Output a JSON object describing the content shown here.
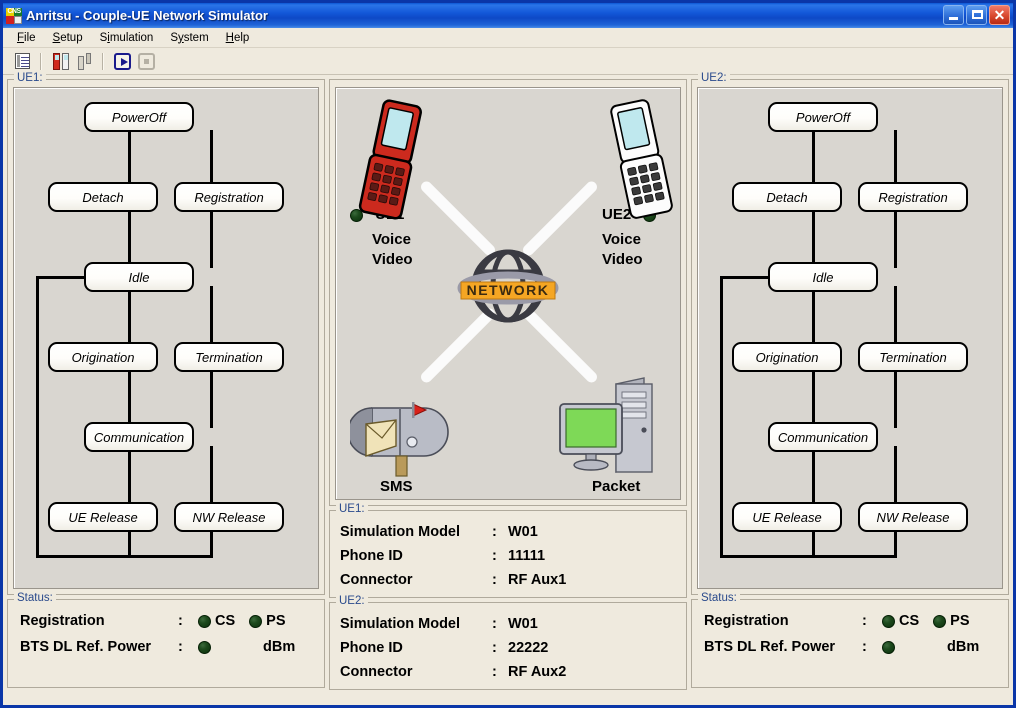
{
  "window": {
    "title": "Anritsu - Couple-UE Network Simulator",
    "icon": "app-icon",
    "buttons": {
      "minimize": "minimize",
      "maximize": "maximize",
      "close": "close"
    }
  },
  "menubar": {
    "items": [
      {
        "label": "File",
        "accel": "F",
        "rest": "ile"
      },
      {
        "label": "Setup",
        "accel": "S",
        "rest": "etup"
      },
      {
        "label": "Simulation",
        "accel": "i",
        "pre": "S",
        "rest": "mulation"
      },
      {
        "label": "System",
        "accel": "y",
        "pre": "S",
        "rest": "stem"
      },
      {
        "label": "Help",
        "accel": "H",
        "rest": "elp"
      }
    ]
  },
  "toolbar": {
    "items": [
      {
        "name": "list-icon",
        "enabled": true
      },
      {
        "name": "phone-pair-icon",
        "enabled": true
      },
      {
        "name": "bts-tower-icon",
        "enabled": true
      },
      {
        "name": "play-icon",
        "enabled": true
      },
      {
        "name": "stop-icon",
        "enabled": false
      }
    ]
  },
  "ue1_panel": {
    "label": "UE1:",
    "nodes": [
      {
        "id": "poweroff",
        "label": "PowerOff"
      },
      {
        "id": "detach",
        "label": "Detach"
      },
      {
        "id": "registration",
        "label": "Registration"
      },
      {
        "id": "idle",
        "label": "Idle"
      },
      {
        "id": "origination",
        "label": "Origination"
      },
      {
        "id": "termination",
        "label": "Termination"
      },
      {
        "id": "communication",
        "label": "Communication"
      },
      {
        "id": "ue_release",
        "label": "UE Release"
      },
      {
        "id": "nw_release",
        "label": "NW Release"
      }
    ]
  },
  "ue2_panel": {
    "label": "UE2:",
    "nodes": [
      {
        "id": "poweroff",
        "label": "PowerOff"
      },
      {
        "id": "detach",
        "label": "Detach"
      },
      {
        "id": "registration",
        "label": "Registration"
      },
      {
        "id": "idle",
        "label": "Idle"
      },
      {
        "id": "origination",
        "label": "Origination"
      },
      {
        "id": "termination",
        "label": "Termination"
      },
      {
        "id": "communication",
        "label": "Communication"
      },
      {
        "id": "ue_release",
        "label": "UE Release"
      },
      {
        "id": "nw_release",
        "label": "NW Release"
      }
    ]
  },
  "network": {
    "hub_label": "NETWORK",
    "hub_banner_color": "#F5A623",
    "devices": {
      "ue1": {
        "label": "UE1",
        "icon": "flip-phone-icon",
        "color": "#CC2A1E",
        "services": [
          "Voice",
          "Video"
        ],
        "led": "on"
      },
      "ue2": {
        "label": "UE2",
        "icon": "flip-phone-icon",
        "color": "#FFFFFF",
        "services": [
          "Voice",
          "Video"
        ],
        "led": "on"
      },
      "sms": {
        "label": "SMS",
        "icon": "mailbox-icon"
      },
      "packet": {
        "label": "Packet",
        "icon": "desktop-computer-icon"
      }
    }
  },
  "ue1_info": {
    "label": "UE1:",
    "rows": [
      {
        "key": "Simulation Model",
        "colon": ":",
        "value": "W01"
      },
      {
        "key": "Phone ID",
        "colon": ":",
        "value": "11111"
      },
      {
        "key": "Connector",
        "colon": ":",
        "value": "RF Aux1"
      }
    ]
  },
  "ue2_info": {
    "label": "UE2:",
    "rows": [
      {
        "key": "Simulation Model",
        "colon": ":",
        "value": "W01"
      },
      {
        "key": "Phone ID",
        "colon": ":",
        "value": "22222"
      },
      {
        "key": "Connector",
        "colon": ":",
        "value": "RF Aux2"
      }
    ]
  },
  "ue1_status": {
    "label": "Status:",
    "registration": {
      "key": "Registration",
      "colon": ":",
      "cs": "CS",
      "ps": "PS"
    },
    "power": {
      "key": "BTS DL Ref. Power",
      "colon": ":",
      "value": "",
      "unit": "dBm"
    }
  },
  "ue2_status": {
    "label": "Status:",
    "registration": {
      "key": "Registration",
      "colon": ":",
      "cs": "CS",
      "ps": "PS"
    },
    "power": {
      "key": "BTS DL Ref. Power",
      "colon": ":",
      "value": "",
      "unit": "dBm"
    }
  }
}
